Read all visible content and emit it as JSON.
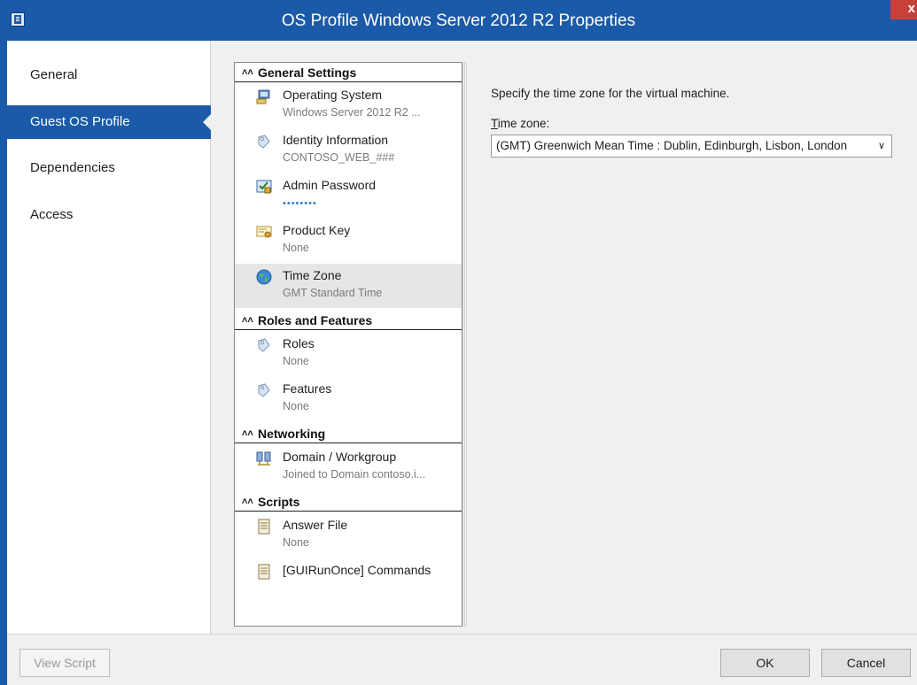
{
  "window": {
    "title": "OS Profile Windows Server 2012 R2 Properties",
    "close_glyph": "x"
  },
  "leftnav": {
    "items": [
      {
        "label": "General"
      },
      {
        "label": "Guest OS Profile",
        "selected": true
      },
      {
        "label": "Dependencies"
      },
      {
        "label": "Access"
      }
    ]
  },
  "tree": {
    "sections": [
      {
        "title": "General Settings"
      },
      {
        "title": "Roles and Features"
      },
      {
        "title": "Networking"
      },
      {
        "title": "Scripts"
      }
    ],
    "items": [
      {
        "label": "Operating System",
        "value": "Windows Server 2012 R2 ...",
        "icon": "operating-system-icon"
      },
      {
        "label": "Identity Information",
        "value": "CONTOSO_WEB_###",
        "icon": "identity-icon"
      },
      {
        "label": "Admin Password",
        "value": "••••••••",
        "icon": "password-icon"
      },
      {
        "label": "Product Key",
        "value": "None",
        "icon": "product-key-icon"
      },
      {
        "label": "Time Zone",
        "value": "GMT Standard Time",
        "icon": "globe-icon",
        "selected": true
      },
      {
        "label": "Roles",
        "value": "None",
        "icon": "roles-icon"
      },
      {
        "label": "Features",
        "value": "None",
        "icon": "features-icon"
      },
      {
        "label": "Domain / Workgroup",
        "value": "Joined to Domain contoso.i...",
        "icon": "domain-icon"
      },
      {
        "label": "Answer File",
        "value": "None",
        "icon": "answer-file-icon"
      },
      {
        "label": "[GUIRunOnce] Commands",
        "value": "",
        "icon": "commands-icon"
      }
    ]
  },
  "detail": {
    "description": "Specify the time zone for the virtual machine.",
    "timezone_label_accel": "T",
    "timezone_label_rest": "ime zone:",
    "timezone_value": "(GMT) Greenwich Mean Time : Dublin, Edinburgh, Lisbon, London"
  },
  "buttons": {
    "view_script": "View Script",
    "ok": "OK",
    "cancel": "Cancel"
  },
  "colors": {
    "accent": "#1a5aa8",
    "close": "#c7403a"
  }
}
